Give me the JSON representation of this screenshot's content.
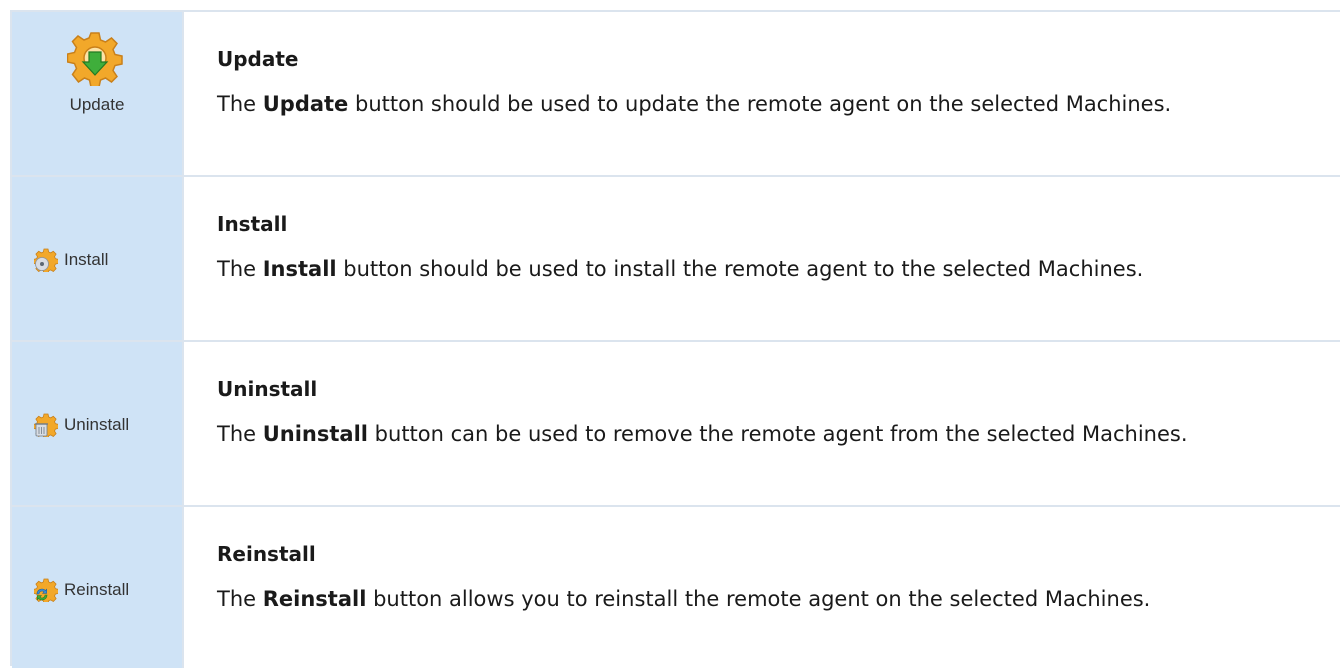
{
  "rows": [
    {
      "button_label": "Update",
      "icon": "update-gear-icon",
      "title": "Update",
      "desc_pre": "The ",
      "desc_bold": "Update",
      "desc_post": " button should be used to update the remote agent on the selected Machines."
    },
    {
      "button_label": "Install",
      "icon": "install-gear-icon",
      "title": "Install",
      "desc_pre": "The ",
      "desc_bold": "Install",
      "desc_post": " button should be used to install the remote agent to the selected Machines."
    },
    {
      "button_label": "Uninstall",
      "icon": "uninstall-gear-icon",
      "title": "Uninstall",
      "desc_pre": "The ",
      "desc_bold": "Uninstall",
      "desc_post": " button can be used to remove the remote agent from the selected Machines."
    },
    {
      "button_label": "Reinstall",
      "icon": "reinstall-gear-icon",
      "title": "Reinstall",
      "desc_pre": "The ",
      "desc_bold": "Reinstall",
      "desc_post": " button allows you to reinstall the remote agent on the selected Machines."
    }
  ],
  "colors": {
    "icon_cell_bg": "#cfe3f6",
    "border": "#dbe4ee",
    "gear": "#f2a82a",
    "arrow": "#3fae3b"
  }
}
